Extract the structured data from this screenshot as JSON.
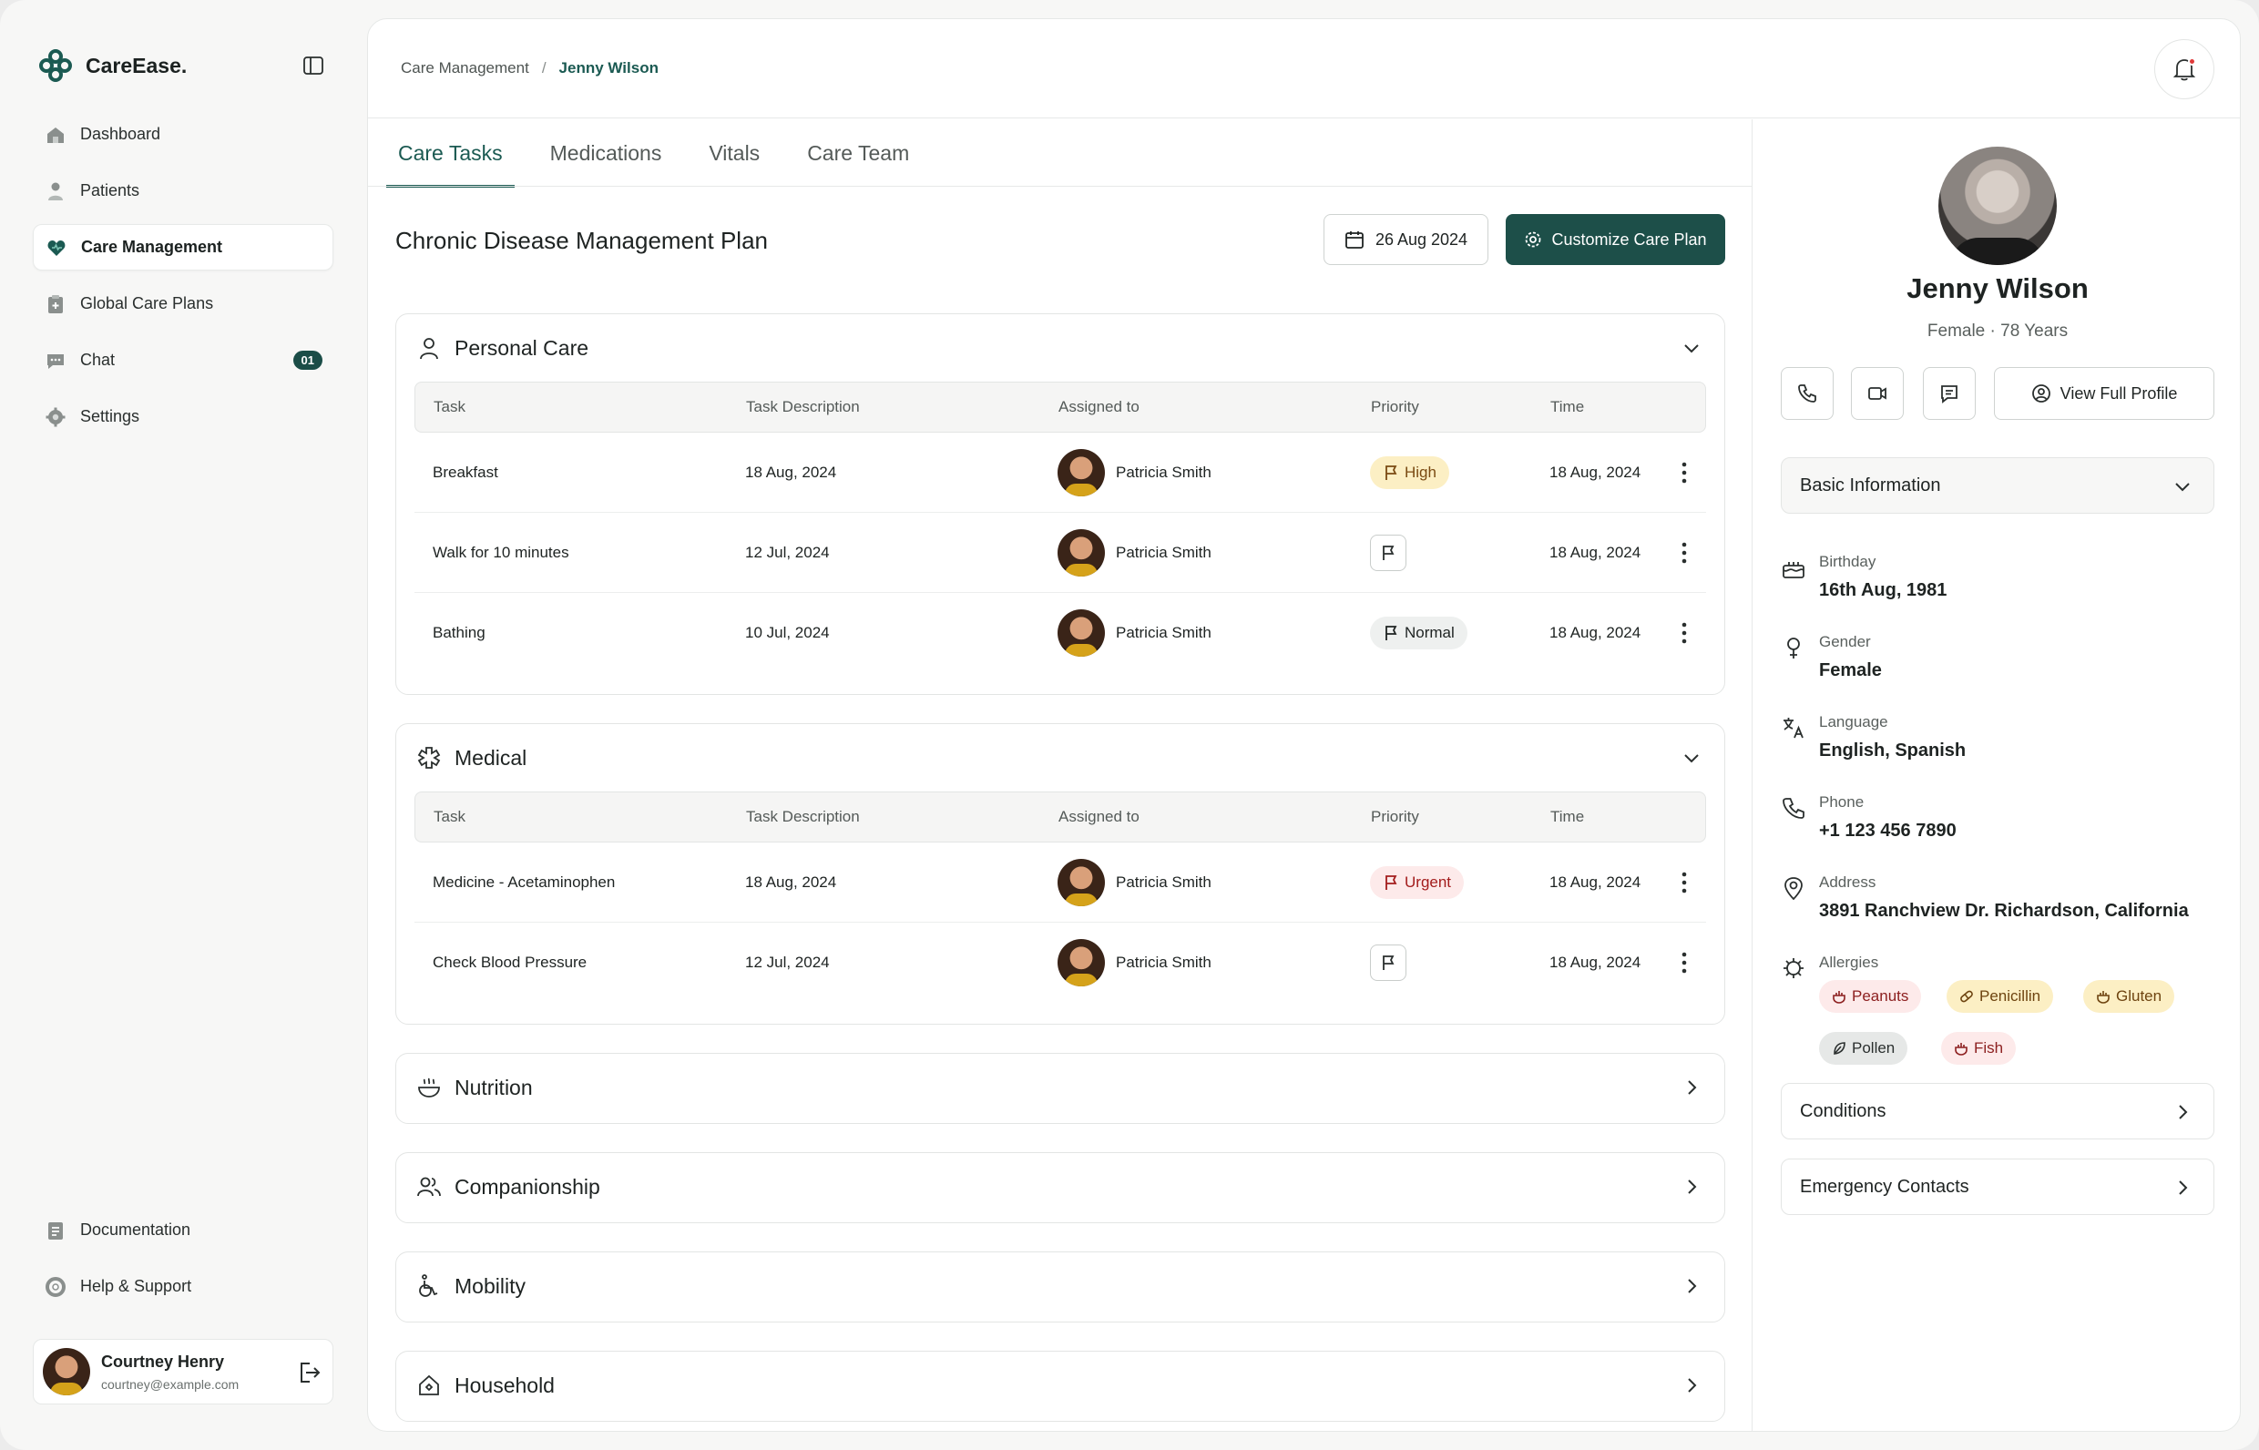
{
  "brand": {
    "name": "CareEase."
  },
  "nav": {
    "items": [
      {
        "label": "Dashboard",
        "icon": "home-icon"
      },
      {
        "label": "Patients",
        "icon": "user-icon"
      },
      {
        "label": "Care Management",
        "icon": "heart-icon",
        "active": true
      },
      {
        "label": "Global Care Plans",
        "icon": "clipboard-icon"
      },
      {
        "label": "Chat",
        "icon": "chat-icon",
        "badge": "01"
      },
      {
        "label": "Settings",
        "icon": "gear-icon"
      }
    ],
    "bottom": [
      {
        "label": "Documentation",
        "icon": "document-icon"
      },
      {
        "label": "Help & Support",
        "icon": "lifebuoy-icon"
      }
    ]
  },
  "user": {
    "name": "Courtney Henry",
    "email": "courtney@example.com"
  },
  "breadcrumb": {
    "parent": "Care Management",
    "separator": "/",
    "current": "Jenny Wilson"
  },
  "tabs": [
    "Care Tasks",
    "Medications",
    "Vitals",
    "Care Team"
  ],
  "plan": {
    "title": "Chronic Disease Management Plan",
    "date": "26 Aug 2024",
    "customize": "Customize Care Plan"
  },
  "columns": [
    "Task",
    "Task Description",
    "Assigned to",
    "Priority",
    "Time"
  ],
  "sections": [
    {
      "title": "Personal Care",
      "rows": [
        {
          "task": "Breakfast",
          "desc": "18 Aug, 2024",
          "assignee": "Patricia Smith",
          "priority": "High",
          "time": "18 Aug, 2024"
        },
        {
          "task": "Walk for 10 minutes",
          "desc": "12 Jul, 2024",
          "assignee": "Patricia Smith",
          "priority": "",
          "time": "18 Aug, 2024"
        },
        {
          "task": "Bathing",
          "desc": "10 Jul, 2024",
          "assignee": "Patricia Smith",
          "priority": "Normal",
          "time": "18 Aug, 2024"
        }
      ]
    },
    {
      "title": "Medical",
      "rows": [
        {
          "task": "Medicine - Acetaminophen",
          "desc": "18 Aug, 2024",
          "assignee": "Patricia Smith",
          "priority": "Urgent",
          "time": "18 Aug, 2024"
        },
        {
          "task": "Check Blood Pressure",
          "desc": "12 Jul, 2024",
          "assignee": "Patricia Smith",
          "priority": "",
          "time": "18 Aug, 2024"
        }
      ]
    },
    {
      "title": "Nutrition"
    },
    {
      "title": "Companionship"
    },
    {
      "title": "Mobility"
    },
    {
      "title": "Household"
    }
  ],
  "patient": {
    "name": "Jenny Wilson",
    "subtitle": "Female · 78 Years",
    "view_profile": "View Full Profile",
    "basic_info": "Basic Information",
    "fields": [
      {
        "label": "Birthday",
        "value": "16th Aug, 1981"
      },
      {
        "label": "Gender",
        "value": "Female"
      },
      {
        "label": "Language",
        "value": "English, Spanish"
      },
      {
        "label": "Phone",
        "value": "+1 123 456 7890"
      },
      {
        "label": "Address",
        "value": "3891 Ranchview Dr. Richardson, California"
      }
    ],
    "allergies_label": "Allergies",
    "allergies": [
      "Peanuts",
      "Penicillin",
      "Gluten",
      "Pollen",
      "Fish"
    ],
    "conditions": "Conditions",
    "emergency": "Emergency Contacts"
  },
  "colors": {
    "accent": "#1b5a52",
    "button": "#1d4f49",
    "high": "#fcefc4",
    "urgent": "#fdeaea"
  }
}
